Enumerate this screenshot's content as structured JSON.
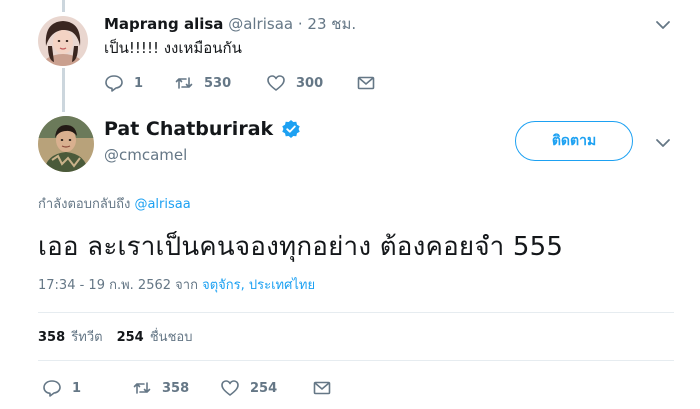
{
  "reply_tweet": {
    "name": "Maprang alisa",
    "handle": "@alrisaa",
    "time": "· 23 ชม.",
    "text": "เป็น!!!!! งงเหมือนกัน",
    "actions": {
      "reply_count": "1",
      "retweet_count": "530",
      "like_count": "300"
    }
  },
  "main_tweet": {
    "name": "Pat Chatburirak",
    "handle": "@cmcamel",
    "follow_label": "ติดตาม",
    "replying_prefix": "กำลังตอบกลับถึง",
    "replying_to": "@alrisaa",
    "text": "เออ ละเราเป็นคนจองทุกอย่าง ต้องคอยจำ 555",
    "timestamp": "17:34 - 19 ก.พ. 2562 จาก",
    "location": "จตุจักร, ประเทศไทย",
    "stats": {
      "retweets_count": "358",
      "retweets_label": "รีทวีต",
      "likes_count": "254",
      "likes_label": "ชื่นชอบ"
    },
    "actions": {
      "reply_count": "1",
      "retweet_count": "358",
      "like_count": "254"
    }
  },
  "icons": {
    "reply": "reply-icon",
    "retweet": "retweet-icon",
    "like": "heart-icon",
    "message": "envelope-icon",
    "verified": "verified-badge-icon",
    "menu": "chevron-down-icon"
  },
  "colors": {
    "accent": "#1da1f2",
    "muted": "#657786",
    "text": "#14171a",
    "divider": "#e6ecf0"
  }
}
